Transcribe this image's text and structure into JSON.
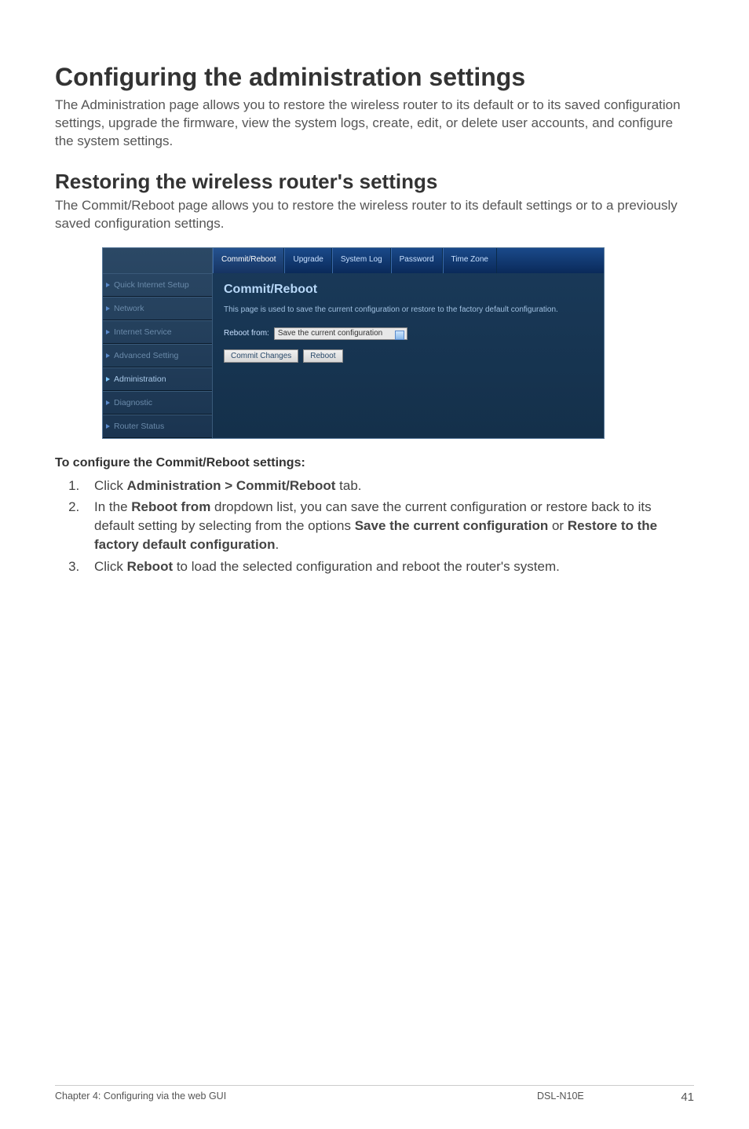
{
  "page": {
    "title": "Configuring the administration settings",
    "intro": "The Administration page allows you to restore the wireless router to its default or to its saved configuration settings, upgrade the firmware, view the system logs, create, edit, or delete user accounts, and configure the system settings.",
    "subtitle": "Restoring the wireless router's settings",
    "sub_intro": "The Commit/Reboot page allows you to restore the wireless router to its default settings or to a previously saved configuration settings."
  },
  "sidebar": {
    "items": [
      {
        "label": "Quick Internet Setup"
      },
      {
        "label": "Network"
      },
      {
        "label": "Internet Service"
      },
      {
        "label": "Advanced Setting"
      },
      {
        "label": "Administration"
      },
      {
        "label": "Diagnostic"
      },
      {
        "label": "Router Status"
      }
    ],
    "active_index": 4
  },
  "tabs": {
    "items": [
      {
        "label": "Commit/Reboot"
      },
      {
        "label": "Upgrade"
      },
      {
        "label": "System Log"
      },
      {
        "label": "Password"
      },
      {
        "label": "Time Zone"
      }
    ],
    "active_index": 0
  },
  "panel": {
    "title": "Commit/Reboot",
    "desc": "This page is used to save the current configuration or restore to the factory default configuration.",
    "reboot_label": "Reboot from:",
    "reboot_selected": "Save the current configuration",
    "btn_commit": "Commit Changes",
    "btn_reboot": "Reboot"
  },
  "instructions": {
    "heading": "To configure the Commit/Reboot settings:",
    "step1_pre": "Click ",
    "step1_bold": "Administration > Commit/Reboot",
    "step1_post": " tab.",
    "step2_pre": "In the ",
    "step2_b1": "Reboot from",
    "step2_mid1": " dropdown list, you can save the current configuration or restore back to its default setting by selecting from the options ",
    "step2_b2": "Save the current configuration",
    "step2_mid2": " or ",
    "step2_b3": "Restore to the factory default configuration",
    "step2_end": ".",
    "step3_pre": "Click ",
    "step3_b1": "Reboot",
    "step3_post": " to load the selected configuration and reboot the router's system."
  },
  "footer": {
    "left": "Chapter 4: Configuring via the web GUI",
    "mid": "DSL-N10E",
    "right": "41"
  }
}
